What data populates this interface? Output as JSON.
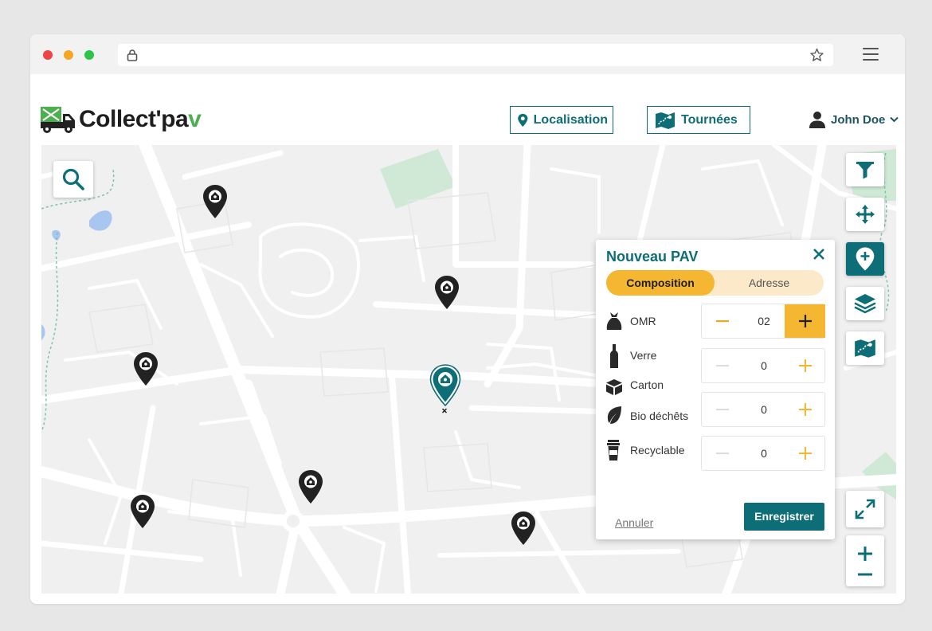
{
  "header": {
    "logo_text": "Collect'pa",
    "logo_accent": "v",
    "nav": [
      {
        "label": "Localisation",
        "icon": "map-pin-icon"
      },
      {
        "label": "Tournées",
        "icon": "route-map-icon"
      }
    ],
    "user_name": "John Doe"
  },
  "map_controls": {
    "search": "search-icon",
    "tools": [
      "filter-icon",
      "move-icon",
      "add-pin-icon",
      "layers-icon",
      "route-map-icon"
    ],
    "bottom": [
      "expand-icon",
      "zoom-in-icon",
      "zoom-out-icon"
    ]
  },
  "panel": {
    "title": "Nouveau PAV",
    "tabs": [
      {
        "label": "Composition",
        "active": true
      },
      {
        "label": "Adresse",
        "active": false
      }
    ],
    "rows": [
      {
        "label": "OMR",
        "icon": "trash-bag-icon",
        "value": "02",
        "active": true
      },
      {
        "label": "Verre",
        "icon": "bottle-icon",
        "value": "0",
        "active": false
      },
      {
        "label": "Carton",
        "icon": "box-icon",
        "value": "0",
        "active": false
      },
      {
        "label": "Bio déchêts",
        "icon": "leaf-icon",
        "value": "0",
        "active": false
      },
      {
        "label": "Recyclable",
        "icon": "cup-icon",
        "value": "0",
        "active": false
      }
    ],
    "cancel_label": "Annuler",
    "save_label": "Enregistrer"
  },
  "colors": {
    "primary": "#0e6e77",
    "accent": "#f5b731",
    "accent_light": "#fbe9c9",
    "logo_green": "#4caf50"
  }
}
